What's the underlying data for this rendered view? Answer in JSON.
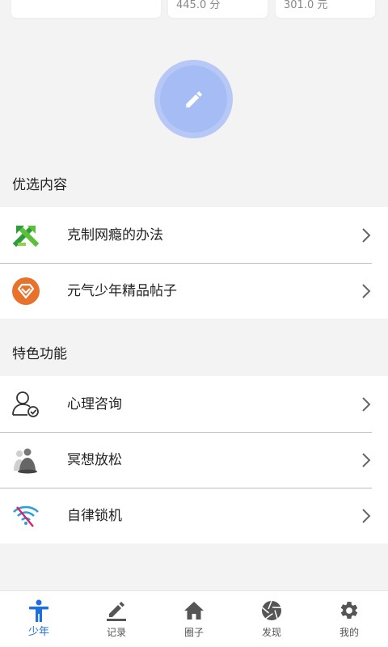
{
  "stats": [
    {
      "value": "445.0 分"
    },
    {
      "value": "301.0 元"
    }
  ],
  "fab": {
    "icon": "pencil-icon"
  },
  "featured": {
    "title": "优选内容",
    "items": [
      {
        "label": "克制网瘾的办法",
        "icon": "green-cross-arrows-icon"
      },
      {
        "label": "元气少年精品帖子",
        "icon": "orange-diamond-badge-icon"
      }
    ]
  },
  "features": {
    "title": "特色功能",
    "items": [
      {
        "label": "心理咨询",
        "icon": "person-check-icon"
      },
      {
        "label": "冥想放松",
        "icon": "meditation-icon"
      },
      {
        "label": "自律锁机",
        "icon": "wifi-blocked-icon"
      }
    ]
  },
  "nav": {
    "items": [
      {
        "label": "少年",
        "icon": "person-icon",
        "active": true
      },
      {
        "label": "记录",
        "icon": "edit-icon",
        "active": false
      },
      {
        "label": "圈子",
        "icon": "home-icon",
        "active": false
      },
      {
        "label": "发现",
        "icon": "aperture-icon",
        "active": false
      },
      {
        "label": "我的",
        "icon": "gear-icon",
        "active": false
      }
    ]
  },
  "colors": {
    "accent": "#1e6fd9",
    "fab": "#a6bcf5",
    "background": "#f3f3f3"
  }
}
